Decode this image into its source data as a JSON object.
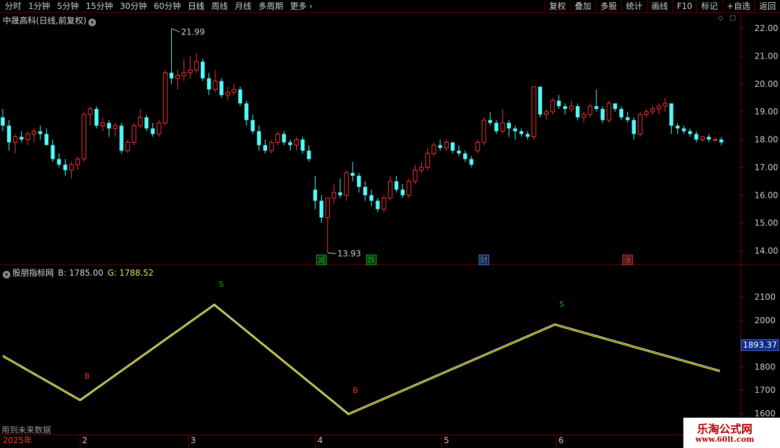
{
  "toolbar": {
    "periods": [
      "分时",
      "1分钟",
      "5分钟",
      "15分钟",
      "30分钟",
      "60分钟",
      "日线",
      "周线",
      "月线",
      "多周期"
    ],
    "active_period": "日线",
    "more_label": "更多",
    "right_buttons": [
      "复权",
      "叠加",
      "多股",
      "统计",
      "画线",
      "F10",
      "标记",
      "+自选",
      "返回"
    ]
  },
  "main_chart": {
    "title": "中晟高科(日线,前复权)",
    "high_label": "21.99",
    "low_label": "13.93",
    "price_axis": [
      "22.00",
      "21.00",
      "20.00",
      "19.00",
      "18.00",
      "17.00",
      "16.00",
      "15.00",
      "14.00"
    ],
    "event_markers": [
      {
        "label": "减",
        "color": "#00c800"
      },
      {
        "label": "跌",
        "color": "#00c800"
      },
      {
        "label": "财",
        "color": "#4a8cff"
      },
      {
        "label": "涨",
        "color": "#ff3232"
      }
    ]
  },
  "indicator": {
    "name": "股朋指标网",
    "b_label": "B: 1785.00",
    "g_label": "G: 1788.52",
    "axis": [
      "2100",
      "2000",
      "1900",
      "1800",
      "1700",
      "1600"
    ],
    "current_value": "1893.37",
    "signals": [
      "B",
      "S",
      "B",
      "S"
    ],
    "future_note": "用到未来数据"
  },
  "time_axis": {
    "year_label": "2025年",
    "months": [
      "2",
      "3",
      "4",
      "5",
      "6"
    ]
  },
  "watermark": {
    "title": "乐淘公式网",
    "url": "www.60lt.com"
  },
  "chart_data": {
    "type": "candlestick",
    "up_color": "#ff3232",
    "down_color": "#54fcfc",
    "ohlc_sample_note": "",
    "candles": [
      [
        18.8,
        19.1,
        18.3,
        18.5
      ],
      [
        18.5,
        18.7,
        17.6,
        17.9
      ],
      [
        17.9,
        18.2,
        17.5,
        18.1
      ],
      [
        18.1,
        18.3,
        17.9,
        18.0
      ],
      [
        18.0,
        18.3,
        17.8,
        18.2
      ],
      [
        18.2,
        18.4,
        17.9,
        18.3
      ],
      [
        18.3,
        18.5,
        18.0,
        18.2
      ],
      [
        18.2,
        18.4,
        17.9,
        17.8
      ],
      [
        17.8,
        18.0,
        17.2,
        17.3
      ],
      [
        17.3,
        17.5,
        17.0,
        17.1
      ],
      [
        17.1,
        17.3,
        16.7,
        16.9
      ],
      [
        16.9,
        17.2,
        16.6,
        17.1
      ],
      [
        17.1,
        17.4,
        16.9,
        17.3
      ],
      [
        17.3,
        19.0,
        17.2,
        18.9
      ],
      [
        18.9,
        19.2,
        18.5,
        19.1
      ],
      [
        19.1,
        19.2,
        18.4,
        18.5
      ],
      [
        18.5,
        18.8,
        18.3,
        18.6
      ],
      [
        18.6,
        18.7,
        18.1,
        18.4
      ],
      [
        18.4,
        18.6,
        18.1,
        18.5
      ],
      [
        18.5,
        18.6,
        17.5,
        17.6
      ],
      [
        17.6,
        18.0,
        17.5,
        17.9
      ],
      [
        17.9,
        18.6,
        17.8,
        18.5
      ],
      [
        18.5,
        19.1,
        18.4,
        18.8
      ],
      [
        18.8,
        18.9,
        18.3,
        18.4
      ],
      [
        18.4,
        18.6,
        18.1,
        18.2
      ],
      [
        18.2,
        18.7,
        18.1,
        18.6
      ],
      [
        18.6,
        20.5,
        18.5,
        20.4
      ],
      [
        20.4,
        21.99,
        20.0,
        20.2
      ],
      [
        20.2,
        20.5,
        19.8,
        20.3
      ],
      [
        20.3,
        20.9,
        20.1,
        20.4
      ],
      [
        20.4,
        21.0,
        20.2,
        20.5
      ],
      [
        20.5,
        21.1,
        20.4,
        20.8
      ],
      [
        20.8,
        20.9,
        20.1,
        20.2
      ],
      [
        20.2,
        20.4,
        19.6,
        19.8
      ],
      [
        19.8,
        20.5,
        19.7,
        20.1
      ],
      [
        20.1,
        20.2,
        19.5,
        19.6
      ],
      [
        19.6,
        19.9,
        19.4,
        19.7
      ],
      [
        19.7,
        20.0,
        19.6,
        19.8
      ],
      [
        19.8,
        19.9,
        19.2,
        19.3
      ],
      [
        19.3,
        19.4,
        18.5,
        18.7
      ],
      [
        18.7,
        18.9,
        18.2,
        18.3
      ],
      [
        18.3,
        18.5,
        17.6,
        17.8
      ],
      [
        17.8,
        18.0,
        17.5,
        17.6
      ],
      [
        17.6,
        18.0,
        17.5,
        17.9
      ],
      [
        17.9,
        18.3,
        17.8,
        18.2
      ],
      [
        18.2,
        18.3,
        17.8,
        17.9
      ],
      [
        17.9,
        18.0,
        17.6,
        17.8
      ],
      [
        17.8,
        18.1,
        17.6,
        18.0
      ],
      [
        18.0,
        18.1,
        17.5,
        17.6
      ],
      [
        17.6,
        17.8,
        17.2,
        17.3
      ],
      [
        16.2,
        16.7,
        15.5,
        15.8
      ],
      [
        15.8,
        16.0,
        15.0,
        15.2
      ],
      [
        15.2,
        15.6,
        13.93,
        15.9
      ],
      [
        15.9,
        16.4,
        15.7,
        16.1
      ],
      [
        16.1,
        16.6,
        15.9,
        16.0
      ],
      [
        16.0,
        16.9,
        15.8,
        16.8
      ],
      [
        16.8,
        17.2,
        16.5,
        16.7
      ],
      [
        16.7,
        16.8,
        16.1,
        16.3
      ],
      [
        16.3,
        16.5,
        15.8,
        16.0
      ],
      [
        16.0,
        16.2,
        15.6,
        15.8
      ],
      [
        15.8,
        15.9,
        15.4,
        15.5
      ],
      [
        15.5,
        16.0,
        15.4,
        15.9
      ],
      [
        15.9,
        16.7,
        15.8,
        16.5
      ],
      [
        16.5,
        16.7,
        16.1,
        16.2
      ],
      [
        16.2,
        16.4,
        15.9,
        16.0
      ],
      [
        16.0,
        16.6,
        15.9,
        16.5
      ],
      [
        16.5,
        17.1,
        16.4,
        16.9
      ],
      [
        16.9,
        17.2,
        16.8,
        17.0
      ],
      [
        17.0,
        17.7,
        16.9,
        17.5
      ],
      [
        17.5,
        17.9,
        17.4,
        17.8
      ],
      [
        17.8,
        18.0,
        17.6,
        17.7
      ],
      [
        17.7,
        18.0,
        17.6,
        17.9
      ],
      [
        17.9,
        17.9,
        17.5,
        17.6
      ],
      [
        17.6,
        17.8,
        17.4,
        17.5
      ],
      [
        17.5,
        17.6,
        17.2,
        17.3
      ],
      [
        17.3,
        17.4,
        17.0,
        17.1
      ],
      [
        17.6,
        18.0,
        17.5,
        17.9
      ],
      [
        17.9,
        18.8,
        17.8,
        18.7
      ],
      [
        18.7,
        19.0,
        18.5,
        18.6
      ],
      [
        18.6,
        18.7,
        18.2,
        18.3
      ],
      [
        18.3,
        19.1,
        18.2,
        18.6
      ],
      [
        18.6,
        18.7,
        18.1,
        18.4
      ],
      [
        18.4,
        18.5,
        18.0,
        18.3
      ],
      [
        18.3,
        18.4,
        18.1,
        18.2
      ],
      [
        18.2,
        18.3,
        18.0,
        18.1
      ],
      [
        18.1,
        19.9,
        18.0,
        19.9
      ],
      [
        19.9,
        19.9,
        18.8,
        18.9
      ],
      [
        18.9,
        19.1,
        18.7,
        19.0
      ],
      [
        19.0,
        19.5,
        18.9,
        19.4
      ],
      [
        19.4,
        19.6,
        19.1,
        19.2
      ],
      [
        19.2,
        19.3,
        18.9,
        19.1
      ],
      [
        19.1,
        19.4,
        19.0,
        19.2
      ],
      [
        19.2,
        19.3,
        18.7,
        18.8
      ],
      [
        18.8,
        19.0,
        18.6,
        18.9
      ],
      [
        18.9,
        19.3,
        18.8,
        19.2
      ],
      [
        19.2,
        19.8,
        19.0,
        19.1
      ],
      [
        19.1,
        19.2,
        18.6,
        18.7
      ],
      [
        18.7,
        19.4,
        18.6,
        19.3
      ],
      [
        19.3,
        19.3,
        19.0,
        19.1
      ],
      [
        19.1,
        19.2,
        18.7,
        18.8
      ],
      [
        18.8,
        19.0,
        18.6,
        18.7
      ],
      [
        18.7,
        18.8,
        18.0,
        18.2
      ],
      [
        18.2,
        19.0,
        18.1,
        18.9
      ],
      [
        18.9,
        19.1,
        18.8,
        19.0
      ],
      [
        19.0,
        19.2,
        18.9,
        19.1
      ],
      [
        19.1,
        19.3,
        18.9,
        19.2
      ],
      [
        19.2,
        19.5,
        19.0,
        19.3
      ],
      [
        19.3,
        19.3,
        18.2,
        18.5
      ],
      [
        18.5,
        18.6,
        18.2,
        18.4
      ],
      [
        18.4,
        18.5,
        18.2,
        18.3
      ],
      [
        18.3,
        18.4,
        18.1,
        18.2
      ],
      [
        18.2,
        18.3,
        17.9,
        18.0
      ],
      [
        18.0,
        18.1,
        17.9,
        18.1
      ],
      [
        18.1,
        18.2,
        17.9,
        18.0
      ],
      [
        18.0,
        18.1,
        17.9,
        18.0
      ],
      [
        18.0,
        18.1,
        17.8,
        17.9
      ]
    ],
    "indicator_series": {
      "name_b": "B",
      "name_g": "G",
      "b_color": "#ffffff",
      "g_color": "#ffff00",
      "pivots": [
        {
          "i": 0,
          "v": 1850
        },
        {
          "i": 15,
          "v": 1660
        },
        {
          "i": 41,
          "v": 2070
        },
        {
          "i": 67,
          "v": 1600
        },
        {
          "i": 107,
          "v": 1985
        },
        {
          "i": 139,
          "v": 1785
        }
      ],
      "total_points": 140,
      "ylim": [
        1600,
        2140
      ]
    }
  }
}
